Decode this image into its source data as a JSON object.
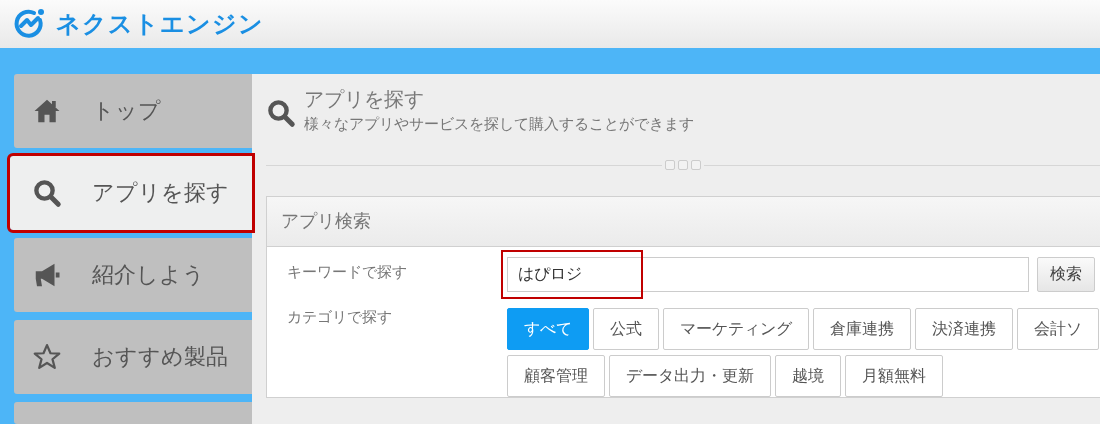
{
  "header": {
    "logo_text": "ネクストエンジン"
  },
  "sidebar": {
    "items": [
      {
        "label": "トップ",
        "selected": false,
        "highlighted": false
      },
      {
        "label": "アプリを探す",
        "selected": true,
        "highlighted": true
      },
      {
        "label": "紹介しよう",
        "selected": false,
        "highlighted": false
      },
      {
        "label": "おすすめ製品",
        "selected": false,
        "highlighted": false
      }
    ]
  },
  "page": {
    "title": "アプリを探す",
    "subtitle": "様々なアプリやサービスを探して購入することができます"
  },
  "search_panel": {
    "title": "アプリ検索",
    "keyword_label": "キーワードで探す",
    "keyword_value": "はぴロジ",
    "keyword_highlighted": true,
    "search_button": "検索",
    "category_label": "カテゴリで探す",
    "category_rows": [
      {
        "items": [
          {
            "label": "すべて",
            "selected": true
          },
          {
            "label": "公式",
            "selected": false
          },
          {
            "label": "マーケティング",
            "selected": false
          },
          {
            "label": "倉庫連携",
            "selected": false
          },
          {
            "label": "決済連携",
            "selected": false
          },
          {
            "label": "会計ソ",
            "selected": false
          }
        ]
      },
      {
        "items": [
          {
            "label": "顧客管理",
            "selected": false
          },
          {
            "label": "データ出力・更新",
            "selected": false
          },
          {
            "label": "越境",
            "selected": false
          },
          {
            "label": "月額無料",
            "selected": false
          }
        ]
      }
    ]
  }
}
